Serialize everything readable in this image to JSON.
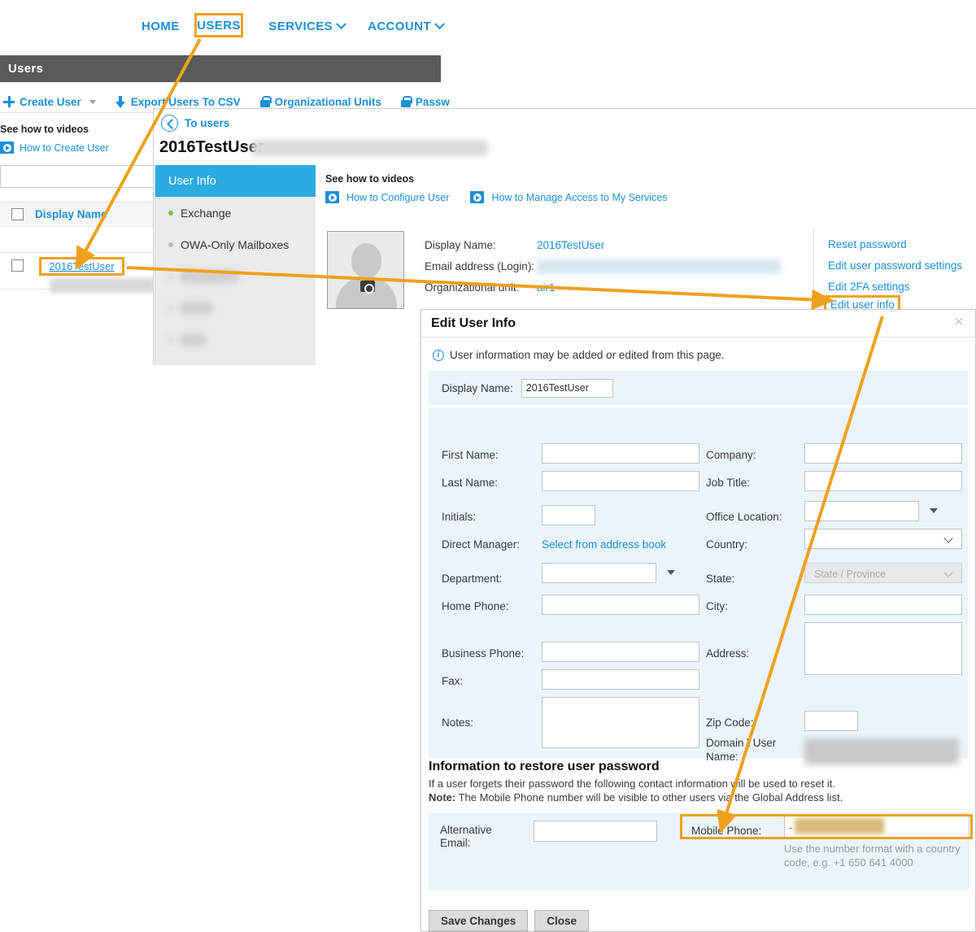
{
  "topnav": {
    "items": [
      {
        "label": "HOME",
        "caret": false
      },
      {
        "label": "USERS",
        "caret": false,
        "highlighted": true
      },
      {
        "label": "SERVICES",
        "caret": true
      },
      {
        "label": "ACCOUNT",
        "caret": true
      }
    ]
  },
  "page": {
    "header_title": "Users"
  },
  "toolbar": {
    "create_user": "Create User",
    "export_csv": "Export Users To CSV",
    "org_units": "Organizational Units",
    "passwords": "Passw"
  },
  "left_videos": {
    "title": "See how to videos",
    "link1": "How to Create User"
  },
  "users_table": {
    "search_value": "",
    "column_header": "Display Name",
    "rows": [
      {
        "display_name": "2016TestUser"
      }
    ]
  },
  "detail": {
    "back_label": "To users",
    "title": "2016TestUser",
    "sidebar": [
      {
        "label": "User Info",
        "state": "active"
      },
      {
        "label": "Exchange",
        "state": "green"
      },
      {
        "label": "OWA-Only Mailboxes",
        "state": "normal"
      },
      {
        "label": "SecuriSync",
        "state": "blurred"
      },
      {
        "label": "Skype",
        "state": "blurred"
      },
      {
        "label": "Sync",
        "state": "blurred"
      }
    ],
    "videos": {
      "title": "See how to videos",
      "link1": "How to Configure User",
      "link2": "How to Manage Access to My Services"
    },
    "fields": [
      {
        "label": "Display Name:",
        "value": "2016TestUser",
        "blurred": false
      },
      {
        "label": "Email address (Login):",
        "value": "",
        "blurred": true
      },
      {
        "label": "Organizational unit:",
        "value": "air1",
        "blurred": false
      }
    ],
    "actions": [
      {
        "label": "Reset password"
      },
      {
        "label": "Edit user password settings"
      },
      {
        "label": "Edit 2FA settings"
      },
      {
        "label": "Edit user info",
        "highlighted": true
      }
    ]
  },
  "modal": {
    "title": "Edit User Info",
    "close_icon": "✕",
    "note": "User information may be added or edited from this page.",
    "display_name_label": "Display Name:",
    "display_name_value": "2016TestUser",
    "left_fields": [
      {
        "label": "First Name:",
        "value": "",
        "type": "text"
      },
      {
        "label": "Last Name:",
        "value": "",
        "type": "text"
      },
      {
        "label": "Initials:",
        "value": "",
        "type": "text-small"
      },
      {
        "label": "Direct Manager:",
        "value": "Select from address book",
        "type": "link"
      },
      {
        "label": "Department:",
        "value": "",
        "type": "combo"
      },
      {
        "label": "Home Phone:",
        "value": "",
        "type": "text"
      },
      {
        "label": "Business Phone:",
        "value": "",
        "type": "text"
      },
      {
        "label": "Fax:",
        "value": "",
        "type": "text"
      },
      {
        "label": "Notes:",
        "value": "",
        "type": "textarea"
      }
    ],
    "right_fields": [
      {
        "label": "Company:",
        "value": "",
        "type": "text"
      },
      {
        "label": "Job Title:",
        "value": "",
        "type": "text"
      },
      {
        "label": "Office Location:",
        "value": "",
        "type": "combo"
      },
      {
        "label": "Country:",
        "value": "",
        "type": "select"
      },
      {
        "label": "State:",
        "value": "",
        "placeholder": "State / Province",
        "type": "select-disabled"
      },
      {
        "label": "City:",
        "value": "",
        "type": "text"
      },
      {
        "label": "Address:",
        "value": "",
        "type": "textarea"
      },
      {
        "label": "Zip Code:",
        "value": "",
        "type": "text-small"
      },
      {
        "label": "Domain \\ User Name:",
        "value": "",
        "type": "readonly-blurred"
      }
    ],
    "restore": {
      "heading": "Information to restore user password",
      "line1": "If a user forgets their password the following contact information will be used to reset it.",
      "line2_bold": "Note:",
      "line2": " The Mobile Phone number will be visible to other users via the Global Address list.",
      "alt_email_label_l1": "Alternative",
      "alt_email_label_l2": "Email:",
      "alt_email_value": "",
      "mobile_label": "Mobile Phone:",
      "mobile_value": "-",
      "mobile_hint": "Use the number format with a country code, e.g. +1 650 641 4000"
    },
    "buttons": {
      "save": "Save Changes",
      "close": "Close"
    }
  },
  "colors": {
    "highlight": "#efa11e",
    "accent_blue": "#1b8fd4",
    "active_tab": "#2caae1",
    "header_bar": "#5a5a5a",
    "form_bg": "#eaf4fa"
  }
}
